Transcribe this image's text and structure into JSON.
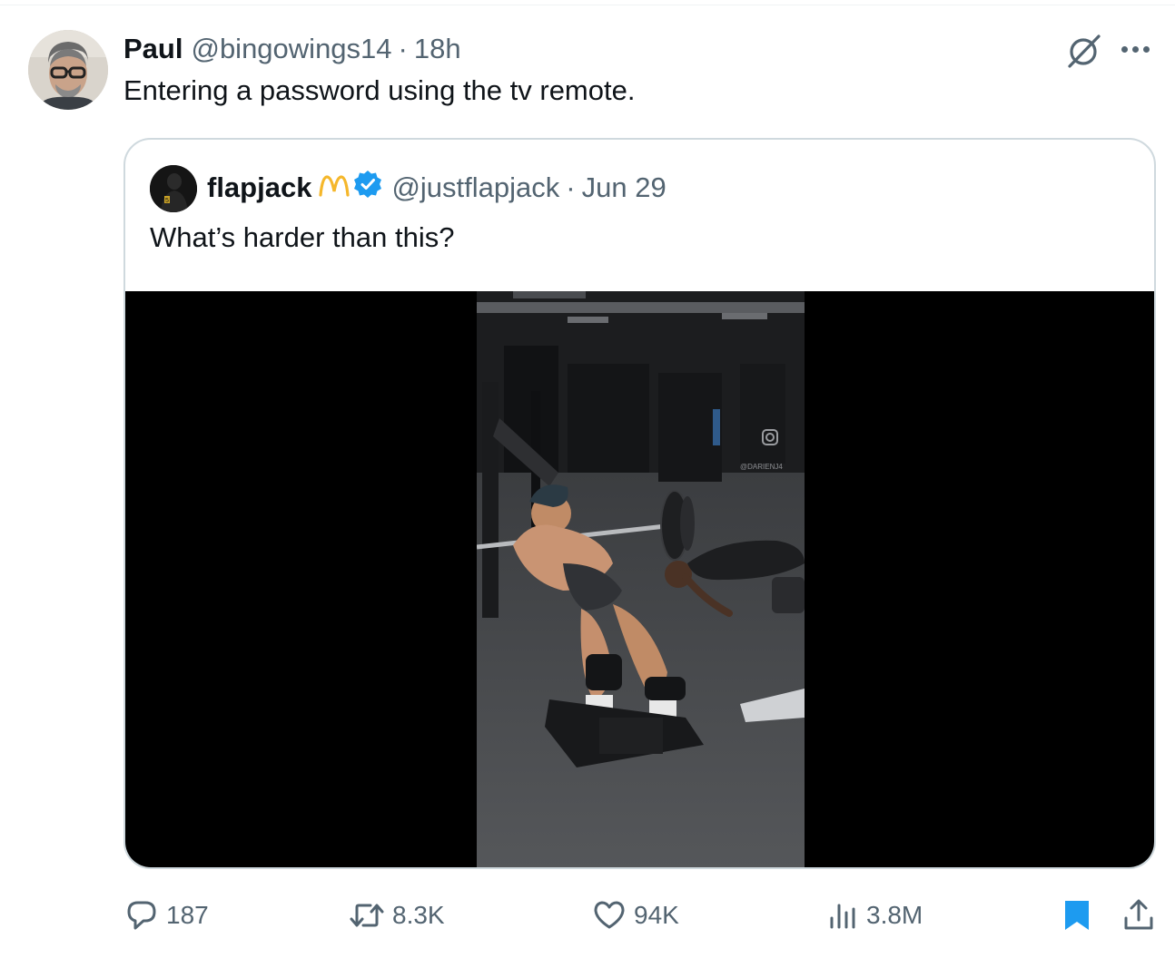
{
  "tweet": {
    "author_name": "Paul",
    "author_handle": "@bingowings14",
    "separator": "·",
    "time": "18h",
    "text": "Entering a password using the tv remote."
  },
  "quoted": {
    "author_name": "flapjack",
    "author_handle": "@justflapjack",
    "separator": "·",
    "date": "Jun 29",
    "text": "What’s harder than this?",
    "badges": [
      "mcdonalds-arches-icon",
      "verified-badge-icon"
    ],
    "media": {
      "type": "video",
      "watermark": "@DARIENJ4"
    }
  },
  "actions": {
    "replies": "187",
    "reposts": "8.3K",
    "likes": "94K",
    "views": "3.8M"
  },
  "colors": {
    "text": "#0f1419",
    "muted": "#536471",
    "border": "#cfd9de",
    "accent": "#1d9bf0",
    "arches": "#f5b72b"
  },
  "icons": [
    "grok-icon",
    "more-icon",
    "reply-icon",
    "repost-icon",
    "like-icon",
    "views-icon",
    "bookmark-icon",
    "share-icon"
  ]
}
